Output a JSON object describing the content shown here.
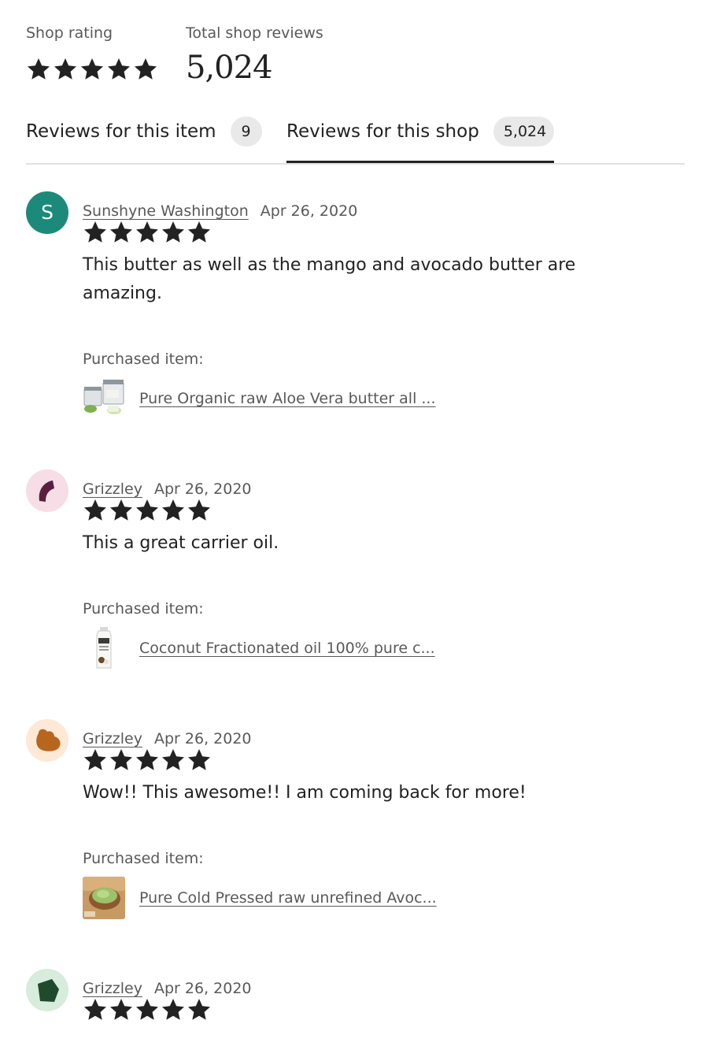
{
  "summary": {
    "shop_rating_label": "Shop rating",
    "shop_rating_stars": 5,
    "total_reviews_label": "Total shop reviews",
    "total_reviews_count": "5,024"
  },
  "tabs": [
    {
      "label": "Reviews for this item",
      "count": "9",
      "active": false
    },
    {
      "label": "Reviews for this shop",
      "count": "5,024",
      "active": true
    }
  ],
  "reviews": [
    {
      "reviewer": "Sunshyne Washington",
      "date": "Apr 26, 2020",
      "avatar_letter": "S",
      "avatar_color": "#1c8a7a",
      "rating": 5,
      "text": "This butter as well as the mango and avocado butter are amazing.",
      "purchased_label": "Purchased item:",
      "item_title": "Pure Organic raw Aloe Vera butter all ..."
    },
    {
      "reviewer": "Grizzley",
      "date": "Apr 26, 2020",
      "avatar_bg": "#f6dde6",
      "avatar_shape_color": "#5a1f3f",
      "rating": 5,
      "text": "This a great carrier oil.",
      "purchased_label": "Purchased item:",
      "item_title": "Coconut Fractionated oil 100% pure c..."
    },
    {
      "reviewer": "Grizzley",
      "date": "Apr 26, 2020",
      "avatar_bg": "#fde9d6",
      "avatar_shape_color": "#b8661e",
      "rating": 5,
      "text": "Wow!! This awesome!! I am coming back for more!",
      "purchased_label": "Purchased item:",
      "item_title": "Pure Cold Pressed raw unrefined Avoc..."
    },
    {
      "reviewer": "Grizzley",
      "date": "Apr 26, 2020",
      "avatar_bg": "#d6ecdc",
      "avatar_shape_color": "#1f4a2e",
      "rating": 5
    }
  ],
  "colors": {
    "text_primary": "#222222",
    "text_secondary": "#595959",
    "badge_bg": "#e9e9e9",
    "divider": "#e1e3df"
  },
  "icons": {
    "star": "star-icon",
    "item_thumbnails": [
      "aloe-butter-jars-thumbnail",
      "coconut-oil-bottle-thumbnail",
      "avocado-butter-bowl-thumbnail"
    ]
  }
}
